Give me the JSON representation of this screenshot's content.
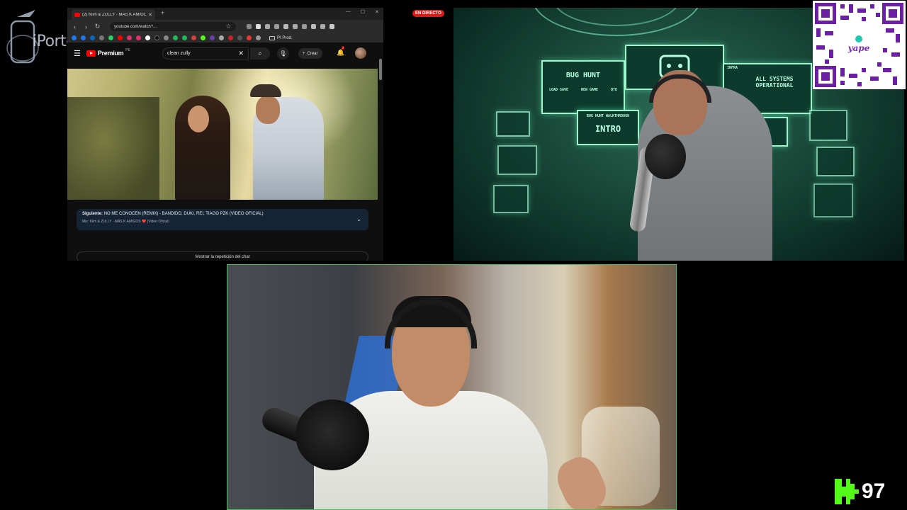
{
  "watermark": {
    "text": "iPorto"
  },
  "browser": {
    "tab": {
      "title": "(2) Klim & ZULLY - MÁS K AMIGOS"
    },
    "url": "youtube.com/watch?...",
    "bookmark_folder": "PI Prod.",
    "youtube": {
      "brand": "Premium",
      "region": "PE",
      "search_value": "clean zully",
      "create_label": "Crear",
      "notification_count": "2",
      "up_next": {
        "label": "Siguiente:",
        "title": "NO ME CONOCEN (REMIX) - BANDIDO, DUKI, REI, TIAGO PZK (VIDEO OFICIAL)",
        "mix": "Mix: Klim & ZULLY - MÁS K AMIGOS ❤️ (Video Oficial)"
      },
      "chat_replay": "Mostrar la repetición del chat"
    }
  },
  "live_badge": "EN DIRECTO",
  "stream_scene": {
    "screen_bug_hunt": "BUG HUNT",
    "screen_status": "ALL SYSTEMS OPERATIONAL",
    "screen_status_tag": "INFRA",
    "screen_intro": "INTRO",
    "screen_menu": [
      "LOAD SAVE",
      "NEW GAME",
      "QTE"
    ],
    "screen_walkthrough": "BUG HUNT WALKTHROUGH"
  },
  "qr": {
    "brand": "yape"
  },
  "viewer_count": "97",
  "colors": {
    "kick_green": "#53fc18",
    "live_red": "#d91a1a",
    "screen_green": "#9ff5cc"
  }
}
